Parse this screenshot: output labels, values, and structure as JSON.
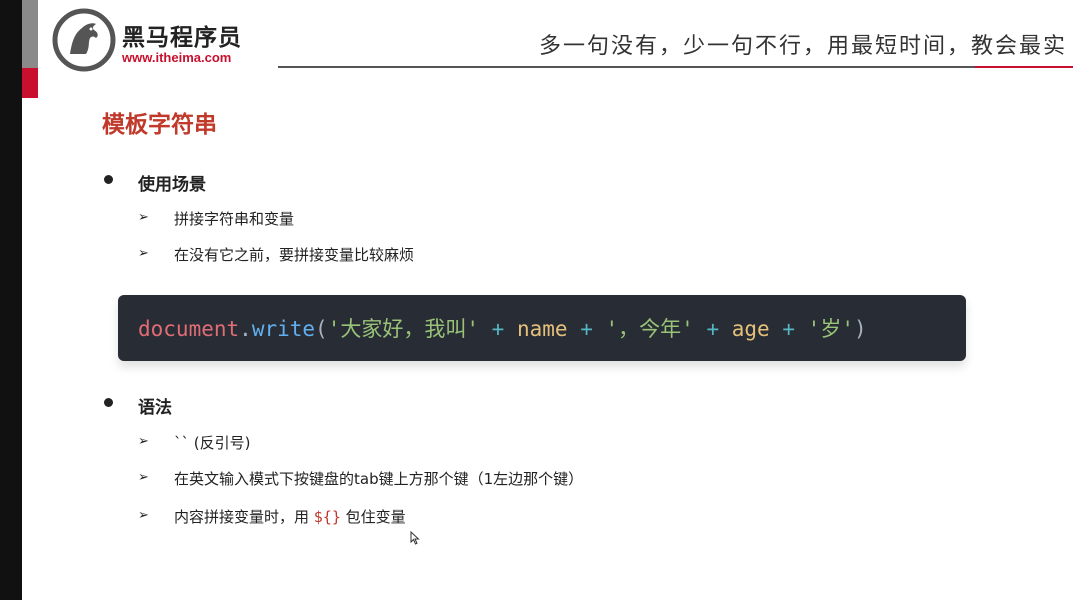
{
  "header": {
    "brand_name": "黑马程序员",
    "brand_url": "www.itheima.com",
    "slogan": "多一句没有，少一句不行，用最短时间，教会最实"
  },
  "slide": {
    "title": "模板字符串",
    "sections": [
      {
        "heading": "使用场景",
        "items": [
          "拼接字符串和变量",
          "在没有它之前，要拼接变量比较麻烦"
        ]
      },
      {
        "heading": "语法",
        "items": [
          "`` (反引号)",
          "在英文输入模式下按键盘的tab键上方那个键（1左边那个键）",
          "内容拼接变量时，用 ",
          "${}",
          " 包住变量"
        ]
      }
    ]
  },
  "code": {
    "object": "document",
    "dot": ".",
    "method": "write",
    "open_paren": "(",
    "str1": "'大家好，我叫'",
    "plus": "+",
    "var1": "name",
    "str2": "'，今年'",
    "var2": "age",
    "str3": "'岁'",
    "close_paren": ")"
  },
  "colors": {
    "accent_red": "#c8102e",
    "title_red": "#c0392b",
    "code_bg": "#282c34"
  },
  "icons": {
    "logo": "horse-logo-icon",
    "bullet": "bullet-dot-icon",
    "arrow": "arrow-bullet-icon",
    "cursor": "mouse-cursor-icon"
  }
}
